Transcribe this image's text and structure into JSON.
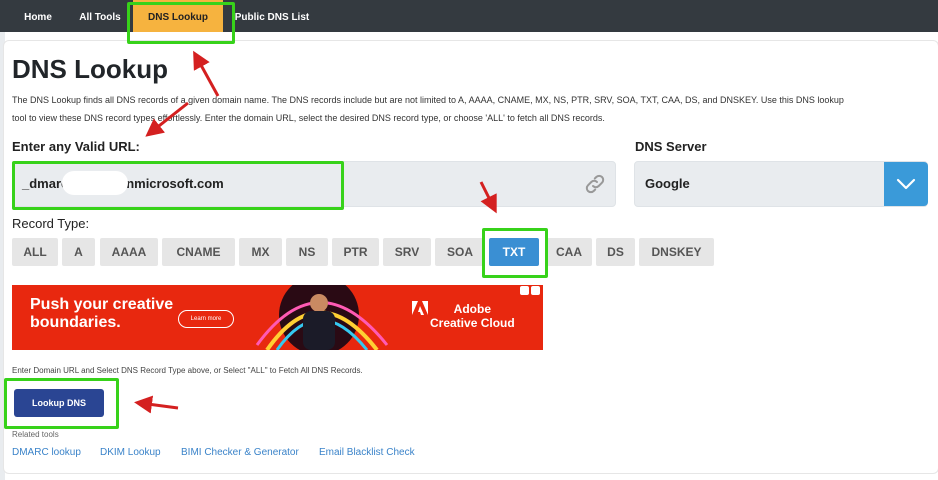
{
  "nav": {
    "items": [
      {
        "label": "Home",
        "active": false
      },
      {
        "label": "All Tools",
        "active": false
      },
      {
        "label": "DNS Lookup",
        "active": true
      },
      {
        "label": "Public DNS List",
        "active": false
      }
    ]
  },
  "page": {
    "title": "DNS Lookup",
    "description_line1": "The DNS Lookup finds all DNS records of a given domain name. The DNS records include but are not limited to A, AAAA, CNAME, MX, NS, PTR, SRV, SOA, TXT, CAA, DS, and DNSKEY. Use this DNS lookup",
    "description_line2": "tool to view these DNS record types effortlessly. Enter the domain URL, select the desired DNS record type, or choose 'ALL' to fetch all DNS records."
  },
  "form": {
    "url_label": "Enter any Valid URL:",
    "url_value_prefix": "_dmarc",
    "url_value_suffix": "onmicrosoft.com",
    "dns_server_label": "DNS Server",
    "dns_server_value": "Google",
    "record_type_label": "Record Type:",
    "record_types": [
      "ALL",
      "A",
      "AAAA",
      "CNAME",
      "MX",
      "NS",
      "PTR",
      "SRV",
      "SOA",
      "TXT",
      "CAA",
      "DS",
      "DNSKEY"
    ],
    "selected_record_type": "TXT",
    "help_text": "Enter Domain URL and Select DNS Record Type above, or Select \"ALL\" to Fetch All DNS Records.",
    "lookup_button": "Lookup DNS"
  },
  "ad": {
    "headline_line1": "Push your creative",
    "headline_line2": "boundaries.",
    "cta": "Learn more",
    "brand_line1": "Adobe",
    "brand_line2": "Creative Cloud"
  },
  "related": {
    "label": "Related tools",
    "tools": [
      "DMARC lookup",
      "DKIM Lookup",
      "BIMI Checker & Generator",
      "Email Blacklist Check"
    ]
  },
  "colors": {
    "nav_bg": "#343a40",
    "nav_active": "#f6b33f",
    "record_active": "#3a8fd3",
    "lookup_button": "#2a4593",
    "highlight": "#37d21a",
    "arrow": "#d42020",
    "link": "#3a83c9"
  }
}
